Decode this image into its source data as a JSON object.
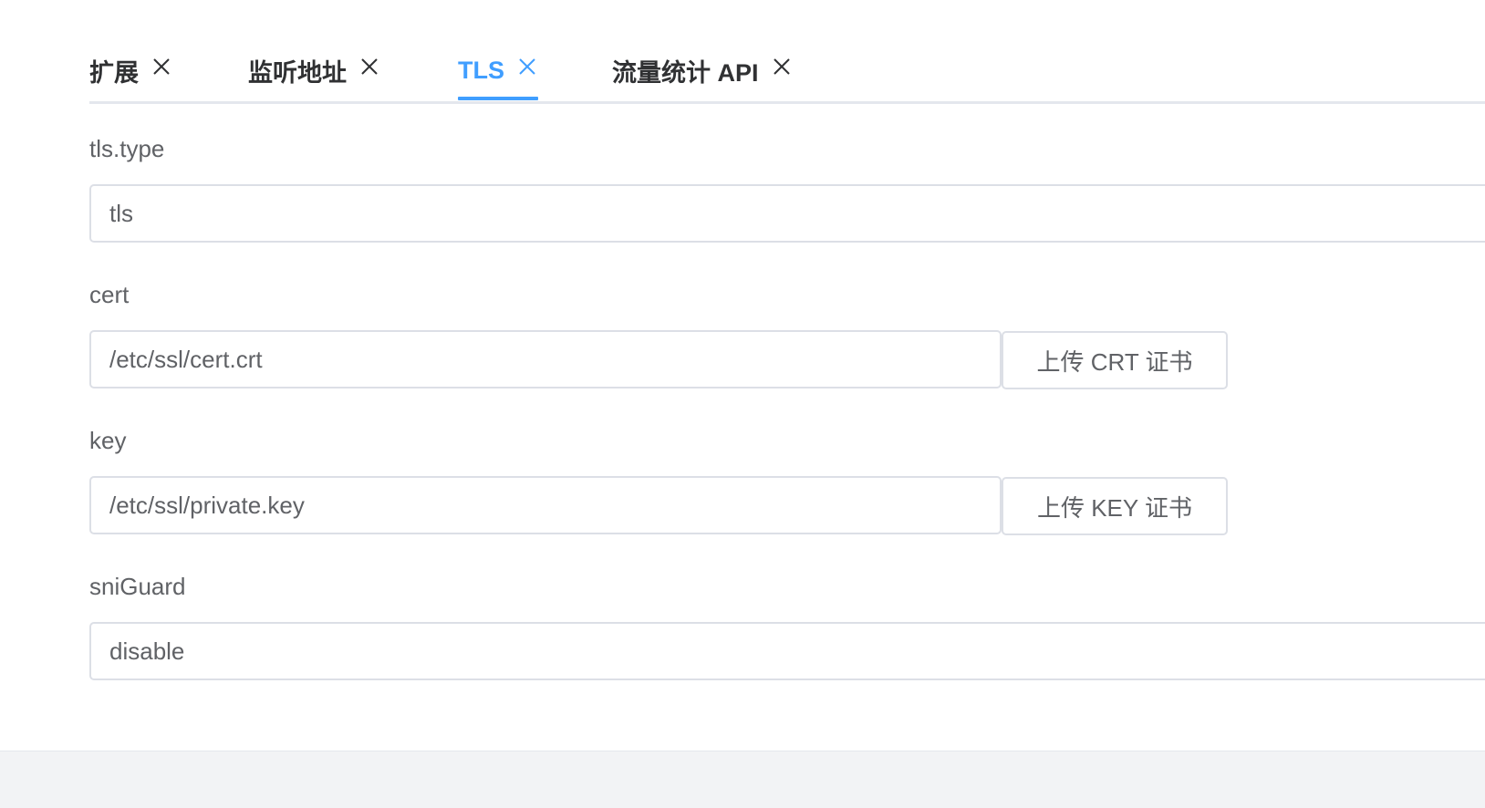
{
  "tabs": [
    {
      "label": "扩展",
      "active": false
    },
    {
      "label": "监听地址",
      "active": false
    },
    {
      "label": "TLS",
      "active": true
    },
    {
      "label": "流量统计 API",
      "active": false
    }
  ],
  "colors": {
    "accent": "#409eff",
    "text": "#606266",
    "border": "#dcdfe6",
    "footer": "#f2f3f5"
  },
  "form": {
    "tls_type": {
      "label": "tls.type",
      "value": "tls"
    },
    "cert": {
      "label": "cert",
      "value": "/etc/ssl/cert.crt",
      "button": "上传 CRT 证书"
    },
    "key": {
      "label": "key",
      "value": "/etc/ssl/private.key",
      "button": "上传 KEY 证书"
    },
    "sni_guard": {
      "label": "sniGuard",
      "value": "disable"
    }
  }
}
